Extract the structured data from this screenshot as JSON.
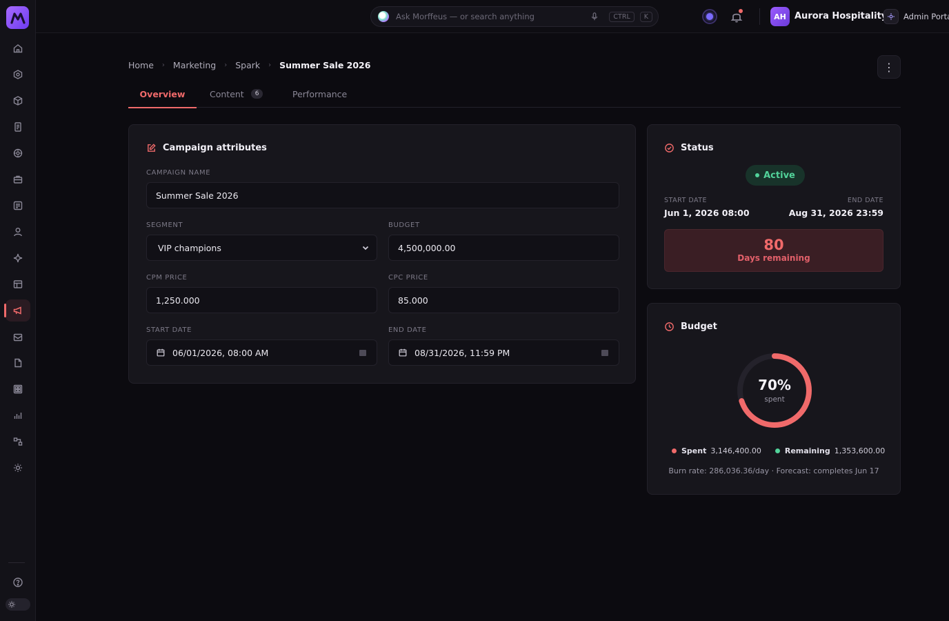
{
  "topbar": {
    "search_placeholder": "Ask Morffeus — or search anything",
    "kbd_ctrl": "CTRL",
    "kbd_k": "K",
    "avatar_initials": "AH",
    "org_name": "Aurora Hospitality",
    "portal_label": "Admin Portal"
  },
  "sidebar": {
    "items": [
      "home-icon",
      "hexagon-icon",
      "cube-icon",
      "clipboard-icon",
      "settings-icon",
      "briefcase-icon",
      "notes-icon",
      "user-icon",
      "sparkle-icon",
      "table-icon",
      "megaphone-icon",
      "ticket-icon",
      "file-icon",
      "grid-icon",
      "bar-chart-icon",
      "flow-icon",
      "sun-icon"
    ],
    "active": "megaphone-icon"
  },
  "breadcrumb": {
    "home": "Home",
    "marketing": "Marketing",
    "spark": "Spark",
    "current": "Summer Sale 2026"
  },
  "tabs": {
    "overview": "Overview",
    "content": "Content",
    "content_count": "6",
    "performance": "Performance"
  },
  "attributes": {
    "title": "Campaign attributes",
    "campaign_name_label": "CAMPAIGN NAME",
    "campaign_name": "Summer Sale 2026",
    "segment_label": "SEGMENT",
    "segment": "VIP champions",
    "budget_label": "BUDGET",
    "budget": "4,500,000.00",
    "cpm_label": "CPM PRICE",
    "cpm": "1,250.000",
    "cpc_label": "CPC PRICE",
    "cpc": "85.000",
    "start_label": "START DATE",
    "start": "06/01/2026, 08:00 AM",
    "end_label": "END DATE",
    "end": "08/31/2026, 11:59 PM"
  },
  "status": {
    "title": "Status",
    "badge": "Active",
    "start_label": "START DATE",
    "start": "Jun 1, 2026 08:00",
    "end_label": "END DATE",
    "end": "Aug 31, 2026 23:59",
    "days": "80",
    "days_label": "Days remaining"
  },
  "budget": {
    "title": "Budget",
    "spent_fraction": 0.7,
    "percent": "70%",
    "percent_sub": "spent",
    "spent_label": "Spent",
    "spent": "3,146,400.00",
    "remaining_label": "Remaining",
    "remaining": "1,353,600.00",
    "burn": "Burn rate: 286,036.36/day · Forecast: completes Jun 17"
  },
  "colors": {
    "accent": "#f06a6a",
    "active_green": "#52d39a",
    "brand": "#8b4dff"
  }
}
